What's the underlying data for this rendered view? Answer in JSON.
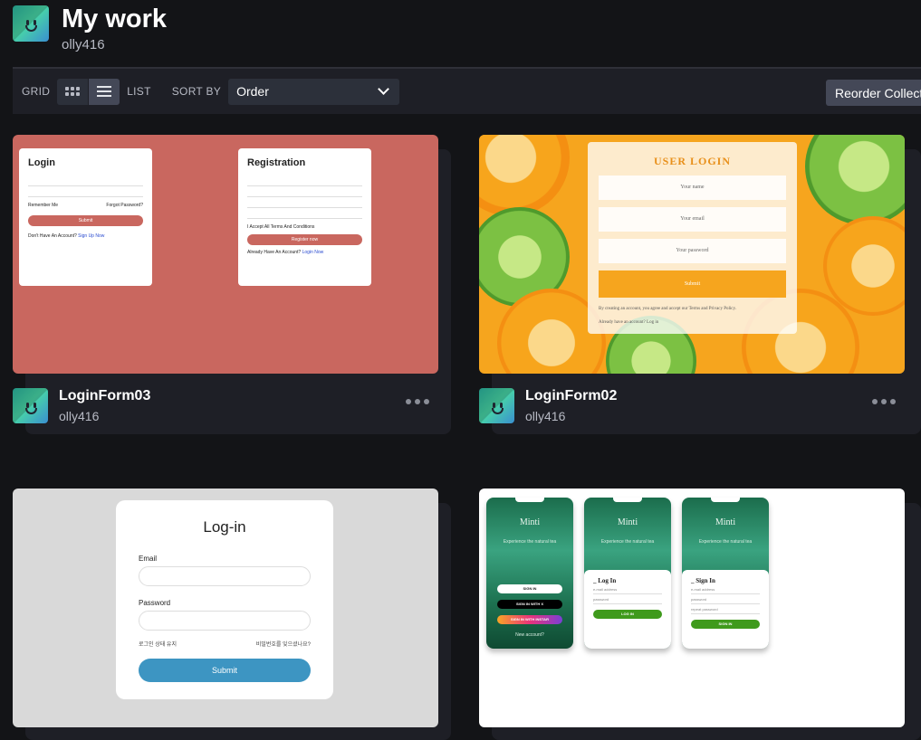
{
  "page": {
    "title": "My work",
    "username": "olly416"
  },
  "toolbar": {
    "grid_label": "GRID",
    "list_label": "LIST",
    "sort_label": "SORT BY",
    "sort_value": "Order",
    "reorder_label": "Reorder Collecti"
  },
  "cards": [
    {
      "name": "LoginForm03",
      "owner": "olly416",
      "preview": {
        "login_title": "Login",
        "remember": "Remember Me",
        "forgot": "Forgot Password?",
        "submit": "Submit",
        "no_account": "Don't Have An Account?",
        "signup_link": "Sign Up Now",
        "reg_title": "Registration",
        "accept": "I Accept All Terms And Conditions",
        "register": "Register now",
        "already": "Already Have An Account?",
        "login_link": "Login Now"
      }
    },
    {
      "name": "LoginForm02",
      "owner": "olly416",
      "preview": {
        "title": "USER LOGIN",
        "name_ph": "Your name",
        "email_ph": "Your email",
        "pass_ph": "Your password",
        "submit": "Submit",
        "terms": "By creating an account, you agree and accept our Terms and Privacy Policy.",
        "already": "Already have an account?",
        "login_link": "Log in"
      }
    },
    {
      "name": "",
      "owner": "",
      "preview": {
        "title": "Log-in",
        "email_label": "Email",
        "password_label": "Password",
        "keep": "로그인 상태 유지",
        "forgot": "비밀번호를 잊으셨나요?",
        "submit": "Submit"
      }
    },
    {
      "name": "",
      "owner": "",
      "preview": {
        "brand": "Minti",
        "tagline": "Experience the natural tea",
        "sign_in": "SIGN IN",
        "sign_in_x": "SIGN IN WITH X",
        "sign_in_insta": "SIGN IN WITH INSTAR",
        "new_account": "New account?",
        "login_title": "_ Log In",
        "email_ph": "e-mail address",
        "pass_ph": "password",
        "login_btn": "LOG IN",
        "signin_title": "_ Sign In",
        "repeat_ph": "repeat password",
        "signin_btn": "SIGN IN"
      }
    }
  ],
  "colors": {
    "background": "#131417",
    "toolbar": "#1e1f26",
    "card1_bg": "#c9675f",
    "card2_accent": "#f6a51e",
    "card3_button": "#3d95c2",
    "card4_green": "#3f9a1c"
  }
}
